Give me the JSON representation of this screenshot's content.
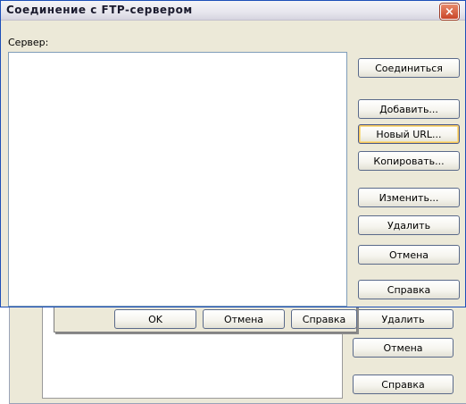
{
  "dialog": {
    "title": "Соединение с FTP-сервером",
    "close_icon": "×",
    "server_label": "Сервер:"
  },
  "buttons": {
    "connect": "Соединиться",
    "add": "Добавить...",
    "new_url": "Новый URL...",
    "copy": "Копировать...",
    "edit": "Изменить...",
    "delete": "Удалить",
    "cancel": "Отмена",
    "help": "Справка"
  },
  "mid_dialog": {
    "ok": "OK",
    "cancel": "Отмена",
    "help": "Справка"
  },
  "back_dialog": {
    "delete": "Удалить",
    "cancel": "Отмена",
    "help": "Справка"
  }
}
